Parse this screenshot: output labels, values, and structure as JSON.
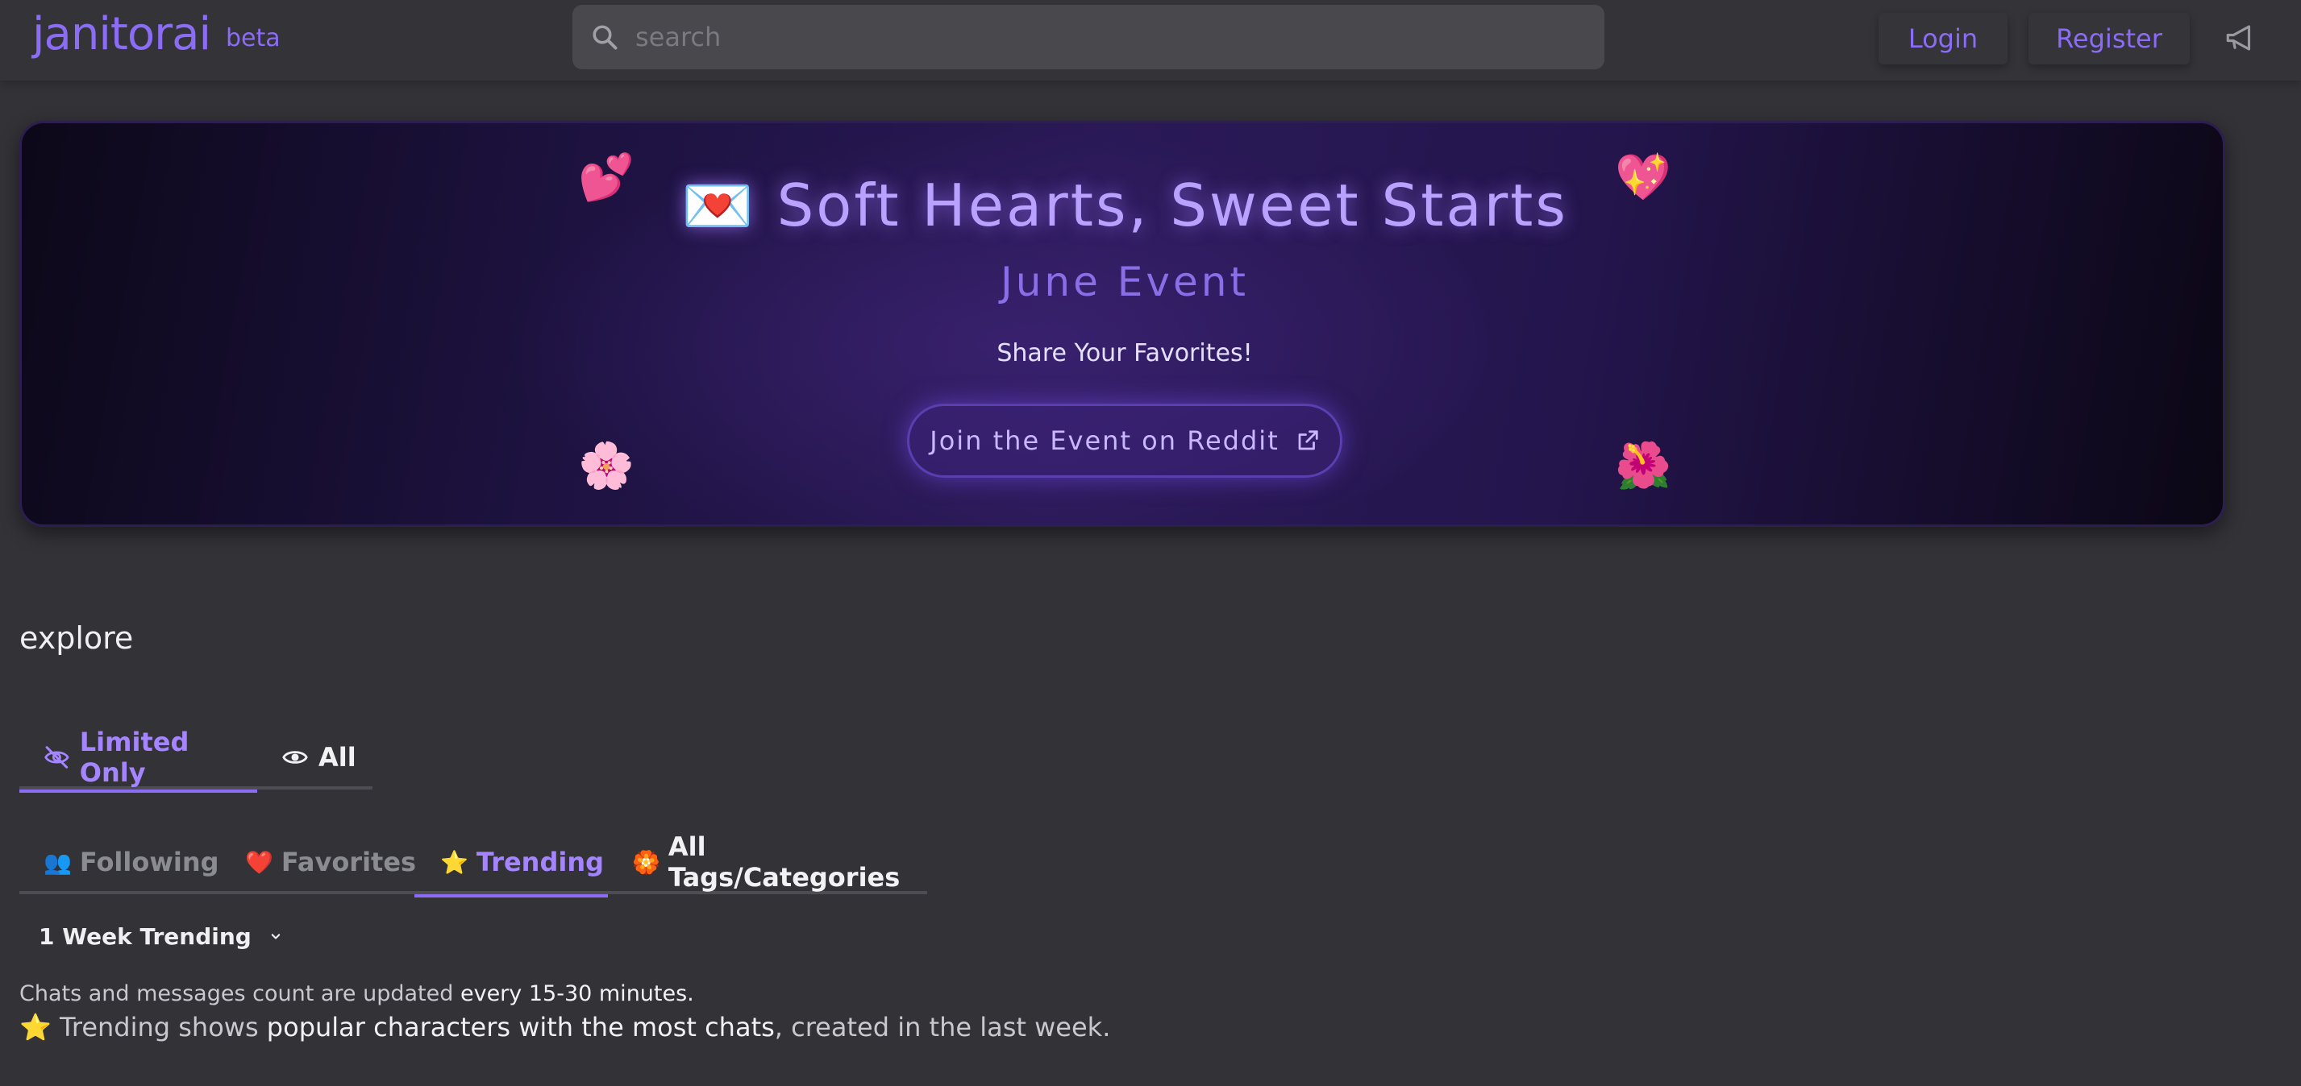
{
  "nav": {
    "logo": "janitorai",
    "beta": "beta",
    "search_placeholder": "search",
    "login": "Login",
    "register": "Register"
  },
  "banner": {
    "title": "💌 Soft Hearts, Sweet Starts",
    "subtitle": "June Event",
    "share": "Share Your Favorites!",
    "button": "Join the Event on Reddit",
    "emojis": [
      "💕",
      "💖",
      "🌸",
      "🌺"
    ]
  },
  "explore": {
    "title": "explore",
    "visibility_tabs": [
      {
        "label": "Limited Only",
        "icon": "eye-slash-icon",
        "active": true
      },
      {
        "label": "All",
        "icon": "eye-icon",
        "active": false
      }
    ],
    "feed_tabs": [
      {
        "icon": "👥",
        "label": "Following",
        "active": false
      },
      {
        "icon": "❤️",
        "label": "Favorites",
        "active": false
      },
      {
        "icon": "⭐",
        "label": "Trending",
        "active": true
      },
      {
        "icon": "🏵️",
        "label": "All Tags/Categories",
        "active": false
      }
    ],
    "trend_select": "1 Week Trending",
    "info_line1_prefix": "Chats and messages count are updated ",
    "info_line1_strong": "every 15-30 minutes.",
    "info_line2_prefix": "⭐ Trending shows ",
    "info_line2_strong": "popular characters with the most chats",
    "info_line2_suffix": ", created in the last week."
  },
  "colors": {
    "accent": "#8b6df5",
    "background": "#323237",
    "search_bg": "#48484d"
  }
}
